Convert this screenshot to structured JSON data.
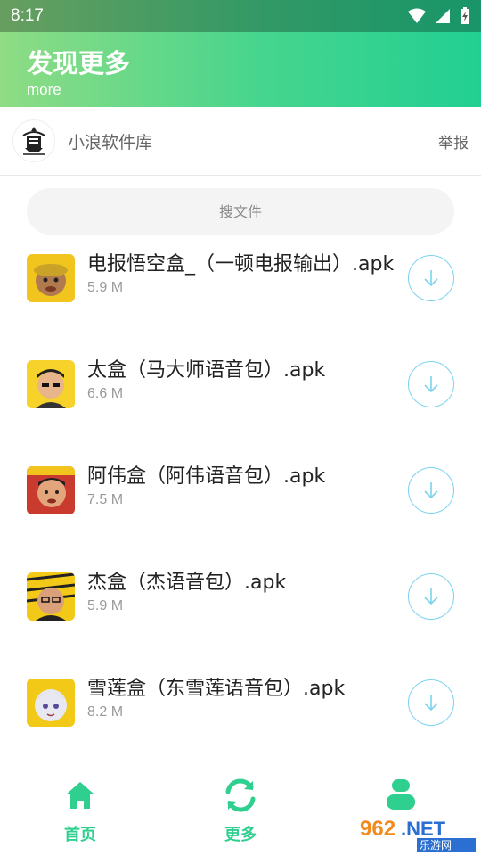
{
  "status_bar": {
    "time": "8:17"
  },
  "header": {
    "title": "发现更多",
    "subtitle": "more"
  },
  "library": {
    "name": "小浪软件库",
    "report_label": "举报"
  },
  "search": {
    "placeholder": "搜文件"
  },
  "files": [
    {
      "name": "电报悟空盒_（一顿电报输出）.apk",
      "size": "5.9 M"
    },
    {
      "name": "太盒（马大师语音包）.apk",
      "size": "6.6 M"
    },
    {
      "name": "阿伟盒（阿伟语音包）.apk",
      "size": "7.5 M"
    },
    {
      "name": "杰盒（杰语音包）.apk",
      "size": "5.9 M"
    },
    {
      "name": "雪莲盒（东雪莲语音包）.apk",
      "size": "8.2 M"
    }
  ],
  "nav": {
    "home_label": "首页",
    "more_label": "更多"
  },
  "colors": {
    "accent": "#2fcf8f",
    "download_ring": "#7ad3ef"
  }
}
